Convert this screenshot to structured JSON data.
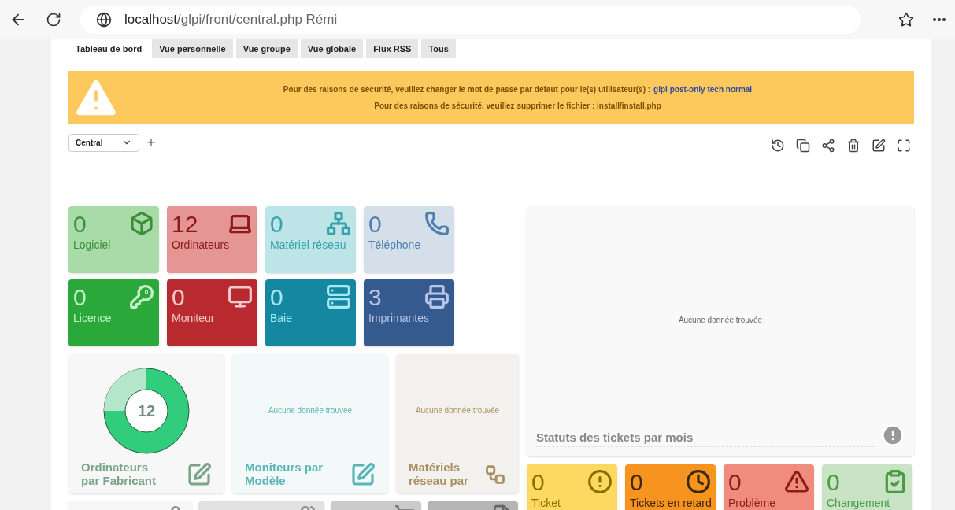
{
  "browser": {
    "url_host": "localhost",
    "url_path": "/glpi/front/central.php Rémi"
  },
  "tabs": [
    {
      "label": "Tableau de bord",
      "selected": true
    },
    {
      "label": "Vue personnelle",
      "selected": false
    },
    {
      "label": "Vue groupe",
      "selected": false
    },
    {
      "label": "Vue globale",
      "selected": false
    },
    {
      "label": "Flux RSS",
      "selected": false
    },
    {
      "label": "Tous",
      "selected": false
    }
  ],
  "alert": {
    "line_1": "Pour des raisons de sécurité, veuillez changer le mot de passe par défaut pour le(s) utilisateur(s) :",
    "users_link": "glpi post-only tech normal",
    "line_2": "Pour des raisons de sécurité, veuillez supprimer le fichier : install/install.php"
  },
  "dashboard_select": {
    "value": "Central"
  },
  "counters": [
    {
      "count": "0",
      "label": "Logiciel",
      "kind": "box",
      "color": "#a9dba9"
    },
    {
      "count": "12",
      "label": "Ordinateurs",
      "kind": "laptop",
      "color": "#e69595"
    },
    {
      "count": "0",
      "label": "Matériel réseau",
      "kind": "network",
      "color": "#bde5e8"
    },
    {
      "count": "0",
      "label": "Téléphone",
      "kind": "phone",
      "color": "#d5dfea"
    },
    {
      "count": "0",
      "label": "Licence",
      "kind": "key",
      "color": "#2aa83a"
    },
    {
      "count": "0",
      "label": "Moniteur",
      "kind": "monitor",
      "color": "#b82a2f"
    },
    {
      "count": "0",
      "label": "Baie",
      "kind": "rack",
      "color": "#1488a1"
    },
    {
      "count": "3",
      "label": "Imprimantes",
      "kind": "printer",
      "color": "#355a8e"
    }
  ],
  "cards": [
    {
      "kind": "donut",
      "title": "Ordinateurs par Fabricant",
      "total": "12",
      "color": "#f6f7f6"
    },
    {
      "kind": "empty",
      "title": "Moniteurs par Modèle",
      "message": "Aucune donnée trouvée",
      "color": "#f3f9f9"
    },
    {
      "kind": "empty",
      "title": "Matériels réseau par",
      "message": "Aucune donnée trouvée",
      "color": "#f3f1ed"
    }
  ],
  "status_chart": {
    "title": "Statuts des tickets par mois",
    "message": "Aucune donnée trouvée"
  },
  "ticket_counters": [
    {
      "count": "0",
      "label": "Ticket",
      "kind": "alert",
      "color": "#fdd962"
    },
    {
      "count": "0",
      "label": "Tickets en retard",
      "kind": "clock",
      "color": "#f7931f"
    },
    {
      "count": "0",
      "label": "Problème",
      "kind": "warning",
      "color": "#f08c7d"
    },
    {
      "count": "0",
      "label": "Changement",
      "kind": "clipboard",
      "color": "#c9e4c5"
    }
  ],
  "partial_cards": [
    {
      "kind": "user",
      "color": "#f6f6f6"
    },
    {
      "kind": "users",
      "color": "#e2e2e2"
    },
    {
      "kind": "cart",
      "color": "#cacaca"
    },
    {
      "kind": "file",
      "color": "#b5b5b5"
    }
  ]
}
